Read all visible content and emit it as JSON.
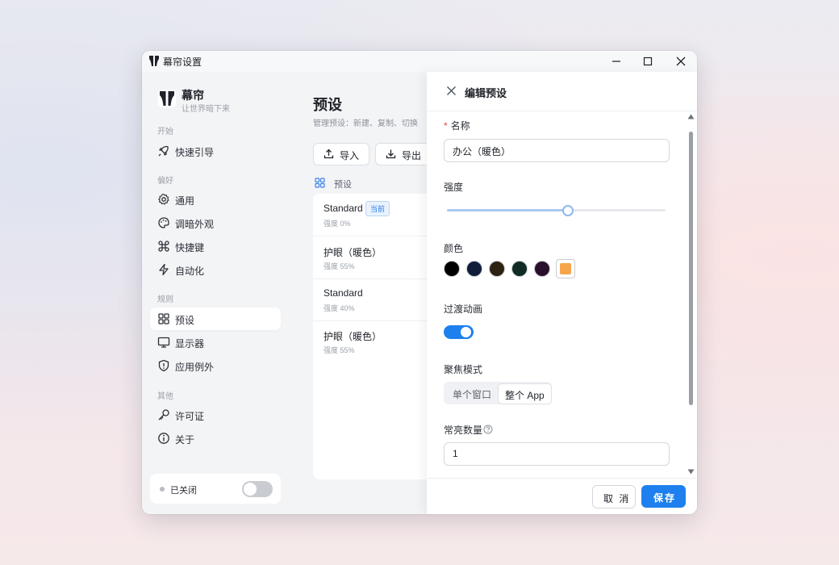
{
  "window": {
    "title": "幕帘设置"
  },
  "brand": {
    "name": "幕帘",
    "subtitle": "让世界暗下来"
  },
  "sidebar": {
    "sections": [
      {
        "label": "开始"
      },
      {
        "label": "偏好"
      },
      {
        "label": "规则"
      },
      {
        "label": "其他"
      }
    ],
    "items": [
      {
        "label": "快速引导",
        "icon": "rocket-icon"
      },
      {
        "label": "通用",
        "icon": "gear-icon"
      },
      {
        "label": "调暗外观",
        "icon": "palette-icon"
      },
      {
        "label": "快捷键",
        "icon": "command-icon"
      },
      {
        "label": "自动化",
        "icon": "lightning-icon"
      },
      {
        "label": "预设",
        "icon": "grid-icon",
        "active": true
      },
      {
        "label": "显示器",
        "icon": "monitor-icon"
      },
      {
        "label": "应用例外",
        "icon": "shield-icon"
      },
      {
        "label": "许可证",
        "icon": "key-icon"
      },
      {
        "label": "关于",
        "icon": "info-icon"
      }
    ],
    "status": {
      "text": "已关闭",
      "enabled": false
    }
  },
  "main": {
    "title": "预设",
    "description": "管理预设：新建、复制、切换",
    "import_label": "导入",
    "export_label": "导出",
    "list_header": "预设",
    "presets": [
      {
        "name": "Standard",
        "badge": "当前",
        "sub": "强度 0%"
      },
      {
        "name": "护眼（暖色）",
        "sub": "强度 55%"
      },
      {
        "name": "Standard",
        "sub": "强度 40%"
      },
      {
        "name": "护眼（暖色）",
        "sub": "强度 55%"
      }
    ]
  },
  "panel": {
    "title": "编辑预设",
    "name_label": "名称",
    "name_value": "办公（暖色）",
    "intensity_label": "强度",
    "intensity_value": 0.55,
    "color_label": "颜色",
    "colors": [
      "#000000",
      "#0f1d3a",
      "#2e2112",
      "#0f2b24",
      "#2a0f2d"
    ],
    "selected_color": "#f5a54a",
    "transition_label": "过渡动画",
    "transition_enabled": true,
    "focus_label": "聚焦模式",
    "focus_options": [
      "单个窗口",
      "整个 App"
    ],
    "focus_selected": "整个 App",
    "always_on_label": "常亮数量",
    "always_on_value": "1",
    "cancel_label": "取 消",
    "save_label": "保存"
  },
  "colors": {
    "accent": "#1e80ee"
  }
}
